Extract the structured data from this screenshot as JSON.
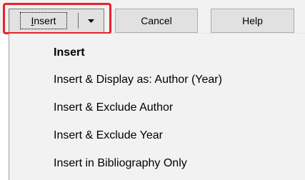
{
  "toolbar": {
    "insert_prefix": "I",
    "insert_rest": "nsert",
    "cancel_label": "Cancel",
    "help_label": "Help"
  },
  "menu": {
    "items": [
      {
        "label": "Insert",
        "default": true
      },
      {
        "label": "Insert & Display as: Author (Year)",
        "default": false
      },
      {
        "label": "Insert & Exclude Author",
        "default": false
      },
      {
        "label": "Insert & Exclude Year",
        "default": false
      },
      {
        "label": "Insert in Bibliography Only",
        "default": false
      }
    ]
  },
  "colors": {
    "highlight": "#e8232a",
    "button_bg": "#e1e1e1",
    "menu_bg": "#f2f2f2"
  },
  "icons": {
    "dropdown": "chevron-down-icon"
  }
}
